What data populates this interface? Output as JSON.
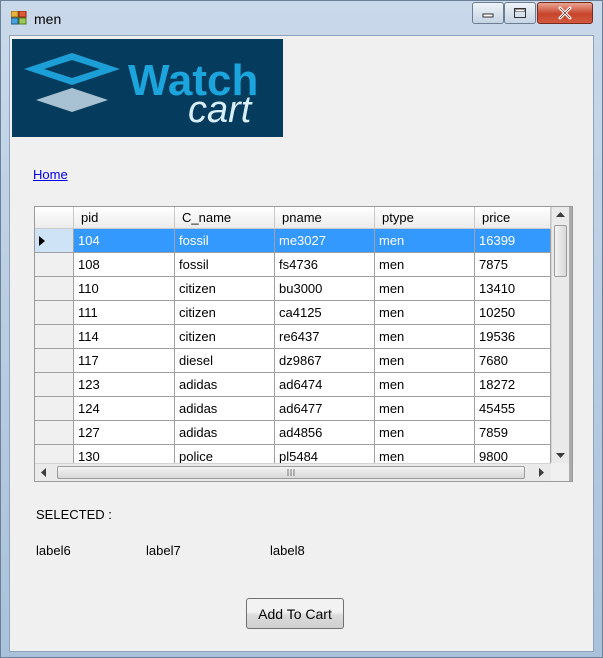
{
  "window": {
    "title": "men",
    "colors": {
      "selection": "#3399ff",
      "link": "#0000ee",
      "banner_bg": "#053b5c",
      "logo_accent": "#1ca4dc"
    }
  },
  "banner": {
    "logo_word1": "Watch",
    "logo_word2": "cart"
  },
  "nav": {
    "home_link": "Home"
  },
  "grid": {
    "columns": [
      "pid",
      "C_name",
      "pname",
      "ptype",
      "price"
    ],
    "selected_row": 0,
    "rows": [
      [
        "104",
        "fossil",
        "me3027",
        "men",
        "16399"
      ],
      [
        "108",
        "fossil",
        "fs4736",
        "men",
        "7875"
      ],
      [
        "110",
        "citizen",
        "bu3000",
        "men",
        "13410"
      ],
      [
        "111",
        "citizen",
        "ca4125",
        "men",
        "10250"
      ],
      [
        "114",
        "citizen",
        "re6437",
        "men",
        "19536"
      ],
      [
        "117",
        "diesel",
        "dz9867",
        "men",
        "7680"
      ],
      [
        "123",
        "adidas",
        "ad6474",
        "men",
        "18272"
      ],
      [
        "124",
        "adidas",
        "ad6477",
        "men",
        "45455"
      ],
      [
        "127",
        "adidas",
        "ad4856",
        "men",
        "7859"
      ],
      [
        "130",
        "police",
        "pl5484",
        "men",
        "9800"
      ]
    ]
  },
  "selection": {
    "heading": "SELECTED :",
    "label6": "label6",
    "label7": "label7",
    "label8": "label8"
  },
  "actions": {
    "add_to_cart": "Add To Cart"
  }
}
